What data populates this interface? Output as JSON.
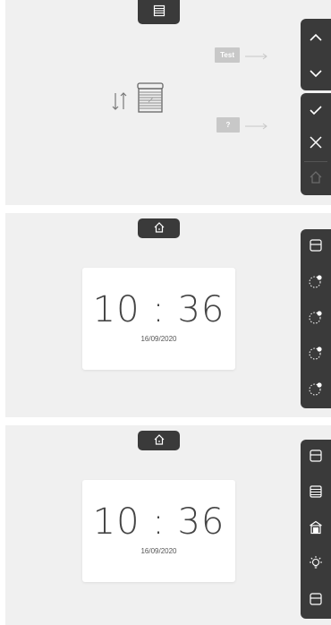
{
  "colors": {
    "panel_bg": "#f0f0f0",
    "dark": "#3a3a3a",
    "light_icon": "#ffffff",
    "muted_icon": "#6a6a6a",
    "hint_tag": "#c8c8c8",
    "card": "#ffffff"
  },
  "panel1": {
    "top_tab_icon": "blind-icon",
    "hints": [
      {
        "label": "Test"
      },
      {
        "label": "?"
      }
    ],
    "center_icons": [
      "up-down-arrows-icon",
      "blind-pencil-icon"
    ],
    "rail_top": [
      "chevron-up-icon",
      "chevron-down-icon"
    ],
    "rail_bottom": [
      "check-icon",
      "close-icon",
      "home-icon"
    ]
  },
  "panel2": {
    "top_tab_icon": "home-icon",
    "clock": {
      "time": "10 : 36",
      "date": "16/09/2020"
    },
    "rail": [
      "window-icon",
      "timer-icon",
      "timer-icon",
      "timer-icon",
      "timer-icon"
    ]
  },
  "panel3": {
    "top_tab_icon": "home-icon",
    "clock": {
      "time": "10 : 36",
      "date": "16/09/2020"
    },
    "rail": [
      "window-icon",
      "blind-icon",
      "garage-icon",
      "bulb-icon",
      "window-icon"
    ]
  }
}
